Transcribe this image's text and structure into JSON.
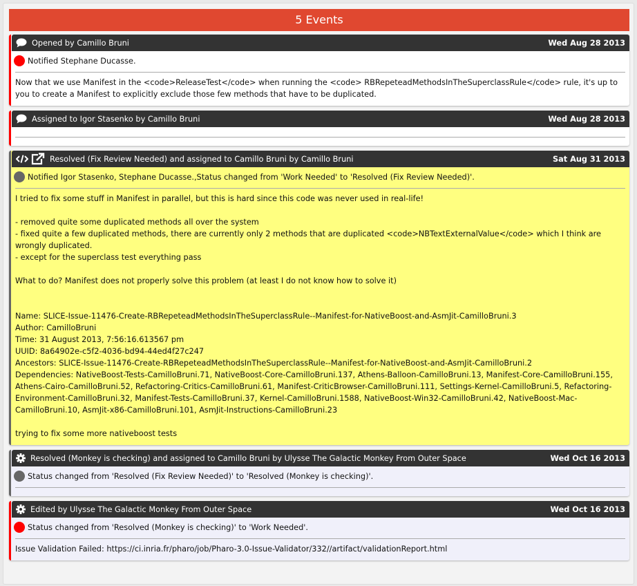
{
  "banner": {
    "title": "5 Events"
  },
  "colors": {
    "red": "#ff0000",
    "grey": "#666666",
    "yellow": "#ffff80",
    "lavender": "#f0f0fa",
    "header": "#333333",
    "banner": "#e04830"
  },
  "events": [
    {
      "icons": [
        "comment-icon"
      ],
      "title": "Opened by Camillo Bruni",
      "date": "Wed Aug 28 2013",
      "border": "red",
      "bg": "white",
      "dot": "red",
      "notice": "Notified Stephane Ducasse.",
      "body": [
        "Now that we use Manifest in the <code>ReleaseTest</code> when running the <code> RBRepeteadMethodsInTheSuperclassRule</code> rule, it's up to you to create a Manifest to explicitly exclude those few methods that have to be duplicated."
      ]
    },
    {
      "icons": [
        "comment-icon"
      ],
      "title": "Assigned to Igor Stasenko by Camillo Bruni",
      "date": "Wed Aug 28 2013",
      "border": "red",
      "bg": "white",
      "dot": null,
      "notice": null,
      "body": []
    },
    {
      "icons": [
        "code-icon",
        "external-link-icon"
      ],
      "title": "Resolved (Fix Review Needed) and assigned to Camillo Bruni by Camillo Bruni",
      "date": "Sat Aug 31 2013",
      "border": "grey",
      "bg": "yellow",
      "dot": "grey",
      "notice": "Notified Igor Stasenko, Stephane Ducasse.,Status changed from 'Work Needed' to 'Resolved (Fix Review Needed)'.",
      "body": [
        "I tried to fix some stuff in Manifest in parallel, but this is hard since this code was never used in real-life!",
        "",
        "- removed quite some duplicated methods all over the system",
        "- fixed quite a few duplicated methods, there are currently only 2 methods that are duplicated <code>NBTextExternalValue</code> which I think are wrongly duplicated.",
        "- except for the superclass test everything pass",
        "",
        "What to do? Manifest does not properly solve this problem (at least I do not know how to solve it)",
        "",
        "",
        "Name: SLICE-Issue-11476-Create-RBRepeteadMethodsInTheSuperclassRule--Manifest-for-NativeBoost-and-AsmJit-CamilloBruni.3",
        "Author: CamilloBruni",
        "Time: 31 August 2013, 7:56:16.613567 pm",
        "UUID: 8a64902e-c5f2-4036-bd94-44ed4f27c247",
        "Ancestors: SLICE-Issue-11476-Create-RBRepeteadMethodsInTheSuperclassRule--Manifest-for-NativeBoost-and-AsmJit-CamilloBruni.2",
        "Dependencies: NativeBoost-Tests-CamilloBruni.71, NativeBoost-Core-CamilloBruni.137, Athens-Balloon-CamilloBruni.13, Manifest-Core-CamilloBruni.155, Athens-Cairo-CamilloBruni.52, Refactoring-Critics-CamilloBruni.61, Manifest-CriticBrowser-CamilloBruni.111, Settings-Kernel-CamilloBruni.5, Refactoring-Environment-CamilloBruni.32, Manifest-Tests-CamilloBruni.37, Kernel-CamilloBruni.1588, NativeBoost-Win32-CamilloBruni.42, NativeBoost-Mac-CamilloBruni.10, AsmJit-x86-CamilloBruni.101, AsmJit-Instructions-CamilloBruni.23",
        "",
        "trying to fix some more nativeboost tests"
      ]
    },
    {
      "icons": [
        "gear-icon"
      ],
      "title": "Resolved (Monkey is checking) and assigned to Camillo Bruni by Ulysse The Galactic Monkey From Outer Space",
      "date": "Wed Oct 16 2013",
      "border": "grey",
      "bg": "lavender",
      "dot": "grey",
      "notice": "Status changed from 'Resolved (Fix Review Needed)' to 'Resolved (Monkey is checking)'.",
      "body": []
    },
    {
      "icons": [
        "gear-icon"
      ],
      "title": "Edited by Ulysse The Galactic Monkey From Outer Space",
      "date": "Wed Oct 16 2013",
      "border": "red",
      "bg": "lavender",
      "dot": "red",
      "notice": "Status changed from 'Resolved (Monkey is checking)' to 'Work Needed'.",
      "body": [
        "Issue Validation Failed: https://ci.inria.fr/pharo/job/Pharo-3.0-Issue-Validator/332//artifact/validationReport.html"
      ]
    }
  ]
}
